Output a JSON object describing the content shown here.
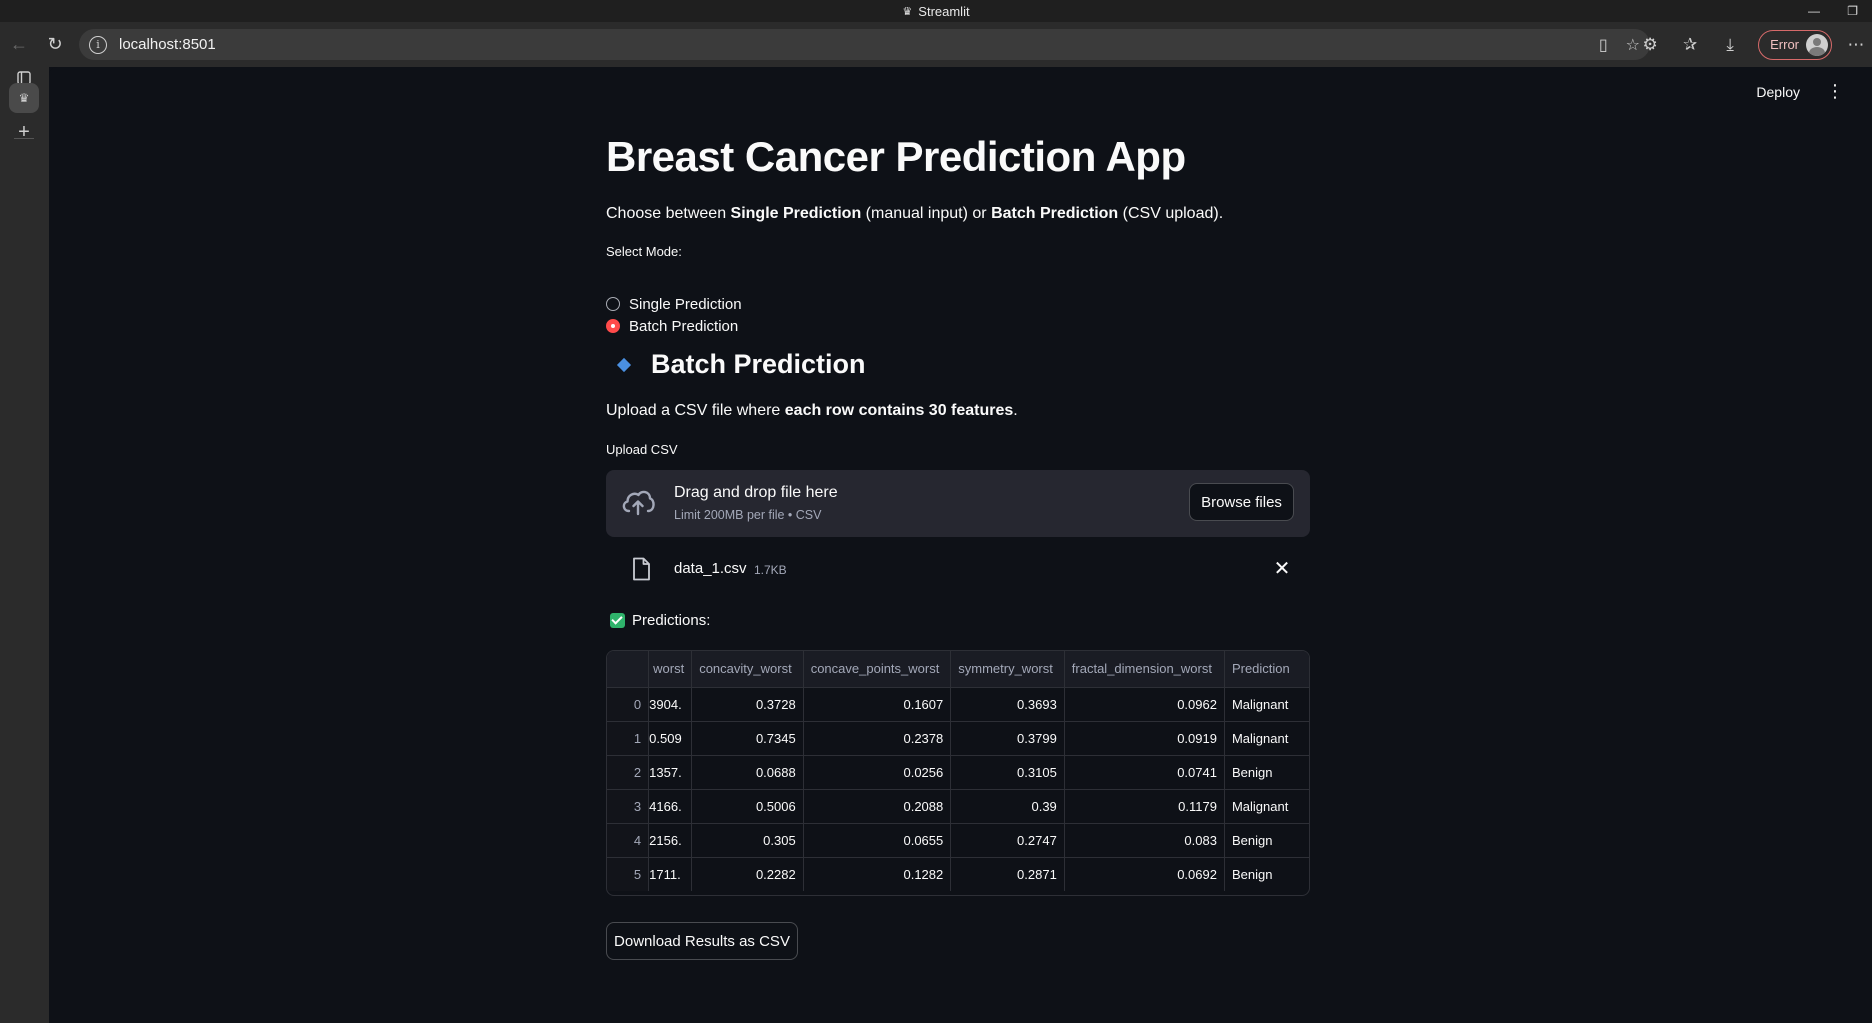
{
  "window": {
    "title": "Streamlit"
  },
  "browser": {
    "url": "localhost:8501",
    "profile_status": "Error"
  },
  "app": {
    "deploy_label": "Deploy",
    "title": "Breast Cancer Prediction App",
    "intro": {
      "prefix": "Choose between ",
      "single": "Single Prediction",
      "middle": " (manual input) or ",
      "batch": "Batch Prediction",
      "suffix": " (CSV upload)."
    },
    "mode": {
      "label": "Select Mode:",
      "options": [
        "Single Prediction",
        "Batch Prediction"
      ],
      "selected": "Batch Prediction"
    },
    "section_title": "Batch Prediction",
    "upload_desc": {
      "prefix": "Upload a CSV file where ",
      "bold": "each row contains 30 features",
      "suffix": "."
    },
    "uploader": {
      "label": "Upload CSV",
      "drag_text": "Drag and drop file here",
      "limit_text": "Limit 200MB per file • CSV",
      "browse_label": "Browse files",
      "file_name": "data_1.csv",
      "file_size": "1.7KB"
    },
    "predictions_label": "Predictions:",
    "table": {
      "columns": [
        "",
        "worst",
        "concavity_worst",
        "concave_points_worst",
        "symmetry_worst",
        "fractal_dimension_worst",
        "Prediction"
      ],
      "rows": [
        [
          "0",
          ".3904",
          "0.3728",
          "0.1607",
          "0.3693",
          "0.0962",
          "Malignant"
        ],
        [
          "1",
          "0.509",
          "0.7345",
          "0.2378",
          "0.3799",
          "0.0919",
          "Malignant"
        ],
        [
          "2",
          ".1357",
          "0.0688",
          "0.0256",
          "0.3105",
          "0.0741",
          "Benign"
        ],
        [
          "3",
          ".4166",
          "0.5006",
          "0.2088",
          "0.39",
          "0.1179",
          "Malignant"
        ],
        [
          "4",
          ".2156",
          "0.305",
          "0.0655",
          "0.2747",
          "0.083",
          "Benign"
        ],
        [
          "5",
          ".1711",
          "0.2282",
          "0.1282",
          "0.2871",
          "0.0692",
          "Benign"
        ]
      ]
    },
    "download_label": "Download Results as CSV"
  },
  "icons": {
    "back": "back-arrow-icon",
    "refresh": "refresh-icon",
    "upload": "cloud-upload-icon",
    "file": "file-icon",
    "close": "close-icon"
  },
  "colors": {
    "background": "#0e1117",
    "secondary_bg": "#262730",
    "primary": "#ff4b4b",
    "diamond": "#4a90e2",
    "check": "#2fb36b"
  }
}
